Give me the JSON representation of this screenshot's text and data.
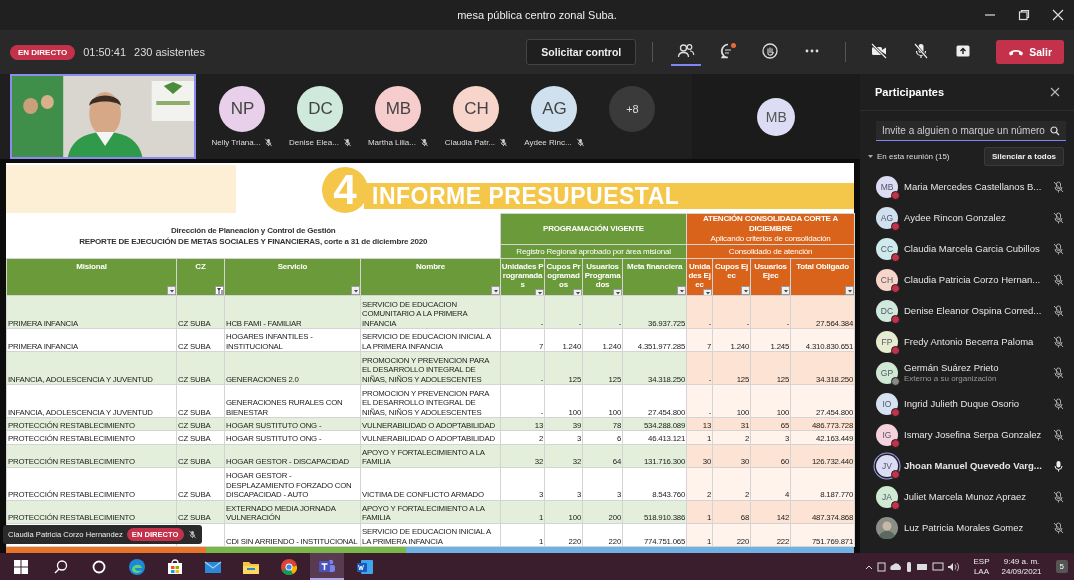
{
  "window": {
    "title": "mesa pública centro zonal Suba."
  },
  "meeting_bar": {
    "live_badge": "EN DIRECTO",
    "elapsed": "01:50:41",
    "attendees": "230 asistentes",
    "request_control": "Solicitar control",
    "leave": "Salir",
    "tools": [
      {
        "kind": "people",
        "selected": true
      },
      {
        "kind": "chat",
        "selected": false,
        "unread": true
      },
      {
        "kind": "hand",
        "selected": false
      },
      {
        "kind": "more",
        "selected": false
      },
      {
        "kind": "camera",
        "selected": false
      },
      {
        "kind": "mic",
        "selected": false
      },
      {
        "kind": "share",
        "selected": false
      }
    ]
  },
  "stage": {
    "avatars": [
      {
        "initials": "NP",
        "name": "Nelly Triana...",
        "color": "#e8d0ea"
      },
      {
        "initials": "DC",
        "name": "Denise Elea...",
        "color": "#cfe9dc"
      },
      {
        "initials": "MB",
        "name": "Martha Lilia...",
        "color": "#f6cccc"
      },
      {
        "initials": "CH",
        "name": "Claudia Patr...",
        "color": "#f8d5ca"
      },
      {
        "initials": "AG",
        "name": "Aydee Rinc...",
        "color": "#cfe1ee"
      }
    ],
    "overflow": "+8",
    "pinned": {
      "initials": "MB",
      "color": "#dcdcf4"
    }
  },
  "shared_sheet": {
    "number": "4",
    "banner": "INFORME PRESUPUESTAL",
    "department": "Dirección de Planeación y Control de Gestión",
    "report": "REPORTE DE EJECUCIÓN DE METAS SOCIALES Y FINANCIERAS, corte a 31 de diciembre 2020",
    "groups": [
      {
        "title": "PROGRAMACIÓN VIGENTE",
        "subtitle": "Registro Regional aprobado por área misional",
        "color": "#6a9a3a"
      },
      {
        "title": "ATENCIÓN CONSOLIDADA CORTE A DICIEMBRE",
        "note": "Aplicando criterios de consolidación",
        "subtitle": "Consolidado de atención",
        "color": "#d9631a"
      }
    ],
    "columns": [
      {
        "label": "Misional",
        "filtered": false
      },
      {
        "label": "CZ",
        "filtered": true
      },
      {
        "label": "Servicio",
        "filtered": false
      },
      {
        "label": "Nombre",
        "filtered": false
      },
      {
        "label": "Unidades Programadas",
        "filtered": false
      },
      {
        "label": "Cupos Programados",
        "filtered": false
      },
      {
        "label": "Usuarios Programados",
        "filtered": false
      },
      {
        "label": "Meta financiera",
        "filtered": false
      },
      {
        "label": "Unidades Ejec",
        "filtered": false
      },
      {
        "label": "Cupos Ejec",
        "filtered": false
      },
      {
        "label": "Usuarios Ejec",
        "filtered": false
      },
      {
        "label": "Total Obligado",
        "filtered": false
      }
    ],
    "rows": [
      {
        "cells": [
          "PRIMERA INFANCIA",
          "CZ SUBA",
          "HCB FAMI - FAMILIAR",
          "SERVICIO DE EDUCACION COMUNITARIO A LA PRIMERA INFANCIA",
          "-",
          "-",
          "-",
          "36.937.725",
          "-",
          "-",
          "-",
          "27.564.384"
        ]
      },
      {
        "cells": [
          "PRIMERA INFANCIA",
          "CZ SUBA",
          "HOGARES INFANTILES - INSTITUCIONAL",
          "SERVICIO DE EDUCACION INICIAL A LA PRIMERA INFANCIA",
          "7",
          "1.240",
          "1.240",
          "4.351.977.285",
          "7",
          "1.240",
          "1.245",
          "4.310.830.651"
        ]
      },
      {
        "cells": [
          "INFANCIA, ADOLESCENCIA Y JUVENTUD",
          "CZ SUBA",
          "GENERACIONES 2.0",
          "PROMOCION Y PREVENCION PARA EL DESARROLLO INTEGRAL DE NIÑAS, NIÑOS Y ADOLESCENTES",
          "-",
          "125",
          "125",
          "34.318.250",
          "-",
          "125",
          "125",
          "34.318.250"
        ]
      },
      {
        "cells": [
          "INFANCIA, ADOLESCENCIA Y JUVENTUD",
          "CZ SUBA",
          "GENERACIONES RURALES CON BIENESTAR",
          "PROMOCION Y PREVENCION PARA EL DESARROLLO INTEGRAL DE NIÑAS, NIÑOS Y ADOLESCENTES",
          "-",
          "100",
          "100",
          "27.454.800",
          "-",
          "100",
          "100",
          "27.454.800"
        ]
      },
      {
        "cells": [
          "PROTECCIÓN RESTABLECIMIENTO",
          "CZ SUBA",
          "HOGAR SUSTITUTO ONG -",
          "VULNERABILIDAD O ADOPTABILIDAD",
          "13",
          "39",
          "78",
          "534.288.089",
          "13",
          "31",
          "65",
          "486.773.728"
        ]
      },
      {
        "cells": [
          "PROTECCIÓN RESTABLECIMIENTO",
          "CZ SUBA",
          "HOGAR SUSTITUTO ONG -",
          "VULNERABILIDAD O ADOPTABILIDAD",
          "2",
          "3",
          "6",
          "46.413.121",
          "1",
          "2",
          "3",
          "42.163.449"
        ]
      },
      {
        "cells": [
          "PROTECCIÓN RESTABLECIMIENTO",
          "CZ SUBA",
          "HOGAR GESTOR - DISCAPACIDAD",
          "APOYO Y FORTALECIMIENTO A LA FAMILIA",
          "32",
          "32",
          "64",
          "131.716.300",
          "30",
          "30",
          "60",
          "126.732.440"
        ]
      },
      {
        "cells": [
          "PROTECCIÓN RESTABLECIMIENTO",
          "CZ SUBA",
          "HOGAR GESTOR - DESPLAZAMIENTO FORZADO CON DISCAPACIDAD - AUTO",
          "VICTIMA DE CONFLICTO ARMADO",
          "3",
          "3",
          "3",
          "8.543.760",
          "2",
          "2",
          "4",
          "8.187.770"
        ]
      },
      {
        "cells": [
          "PROTECCIÓN RESTABLECIMIENTO",
          "CZ SUBA",
          "EXTERNADO MEDIA JORNADA VULNERACIÓN",
          "APOYO Y FORTALECIMIENTO A LA FAMILIA",
          "1",
          "100",
          "200",
          "518.910.386",
          "1",
          "68",
          "142",
          "487.374.868"
        ]
      },
      {
        "cells": [
          null,
          null,
          "CDI SIN ARRIENDO - INSTITUCIONAL",
          "SERVICIO DE EDUCACION INICIAL A LA PRIMERA INFANCIA",
          "1",
          "220",
          "220",
          "774.751.065",
          "1",
          "220",
          "222",
          "751.769.871"
        ]
      }
    ]
  },
  "presenter_label": {
    "name": "Claudia Patricia Corzo Hernandez",
    "live": "EN DIRECTO"
  },
  "participants_panel": {
    "title": "Participantes",
    "search": {
      "placeholder": "Invite a alguien o marque un número"
    },
    "section": "En esta reunión (15)",
    "mute_all": "Silenciar a todos",
    "people": [
      {
        "initials": "MB",
        "name": "Maria Mercedes Castellanos B...",
        "color": "#dcdcf4",
        "external": false,
        "muted": true,
        "speaking": false
      },
      {
        "initials": "AG",
        "name": "Aydee Rincon Gonzalez",
        "color": "#cfe1ee",
        "external": false,
        "muted": true,
        "speaking": false
      },
      {
        "initials": "CC",
        "name": "Claudia Marcela Garcia Cubillos",
        "color": "#cfeaec",
        "external": false,
        "muted": true,
        "speaking": false
      },
      {
        "initials": "CH",
        "name": "Claudia Patricia Corzo Hernan...",
        "color": "#f8d5ca",
        "external": false,
        "muted": true,
        "speaking": false
      },
      {
        "initials": "DC",
        "name": "Denise Eleanor Ospina Corred...",
        "color": "#cfe9dc",
        "external": false,
        "muted": true,
        "speaking": false
      },
      {
        "initials": "FP",
        "name": "Fredy Antonio Becerra Paloma",
        "color": "#e6eccf",
        "external": false,
        "muted": true,
        "speaking": false
      },
      {
        "initials": "GP",
        "name": "Germán Suárez Prieto",
        "subtitle": "Externo a su organización",
        "color": "#cfe9d4",
        "external": true,
        "muted": true,
        "speaking": false
      },
      {
        "initials": "IO",
        "name": "Ingrid Julieth Duque Osorio",
        "color": "#d6e2f2",
        "external": false,
        "muted": true,
        "speaking": false
      },
      {
        "initials": "IG",
        "name": "Ismary Josefina Serpa Gonzalez",
        "color": "#f6d3dc",
        "external": false,
        "muted": true,
        "speaking": false
      },
      {
        "initials": "JV",
        "name": "Jhoan Manuel Quevedo Varg...",
        "color": "#dcdcf4",
        "external": false,
        "muted": false,
        "speaking": true
      },
      {
        "initials": "JA",
        "name": "Juliet Marcela Munoz Apraez",
        "color": "#cfe9d4",
        "external": false,
        "muted": true,
        "speaking": false
      },
      {
        "name": "Luz Patricia Morales Gomez",
        "muted": true,
        "speaking": false
      }
    ]
  },
  "taskbar": {
    "apps": [
      {
        "kind": "search",
        "selected": false
      },
      {
        "kind": "cortana",
        "selected": false
      },
      {
        "kind": "edge",
        "selected": false
      },
      {
        "kind": "store",
        "selected": false
      },
      {
        "kind": "mail",
        "selected": false
      },
      {
        "kind": "files",
        "selected": false
      },
      {
        "kind": "chrome",
        "selected": false
      },
      {
        "kind": "teams",
        "selected": true
      },
      {
        "kind": "word",
        "selected": false
      }
    ],
    "language": "ESP",
    "layout": "LAA",
    "time": "9:49 a. m.",
    "date": "24/09/2021",
    "notifications": "5"
  }
}
